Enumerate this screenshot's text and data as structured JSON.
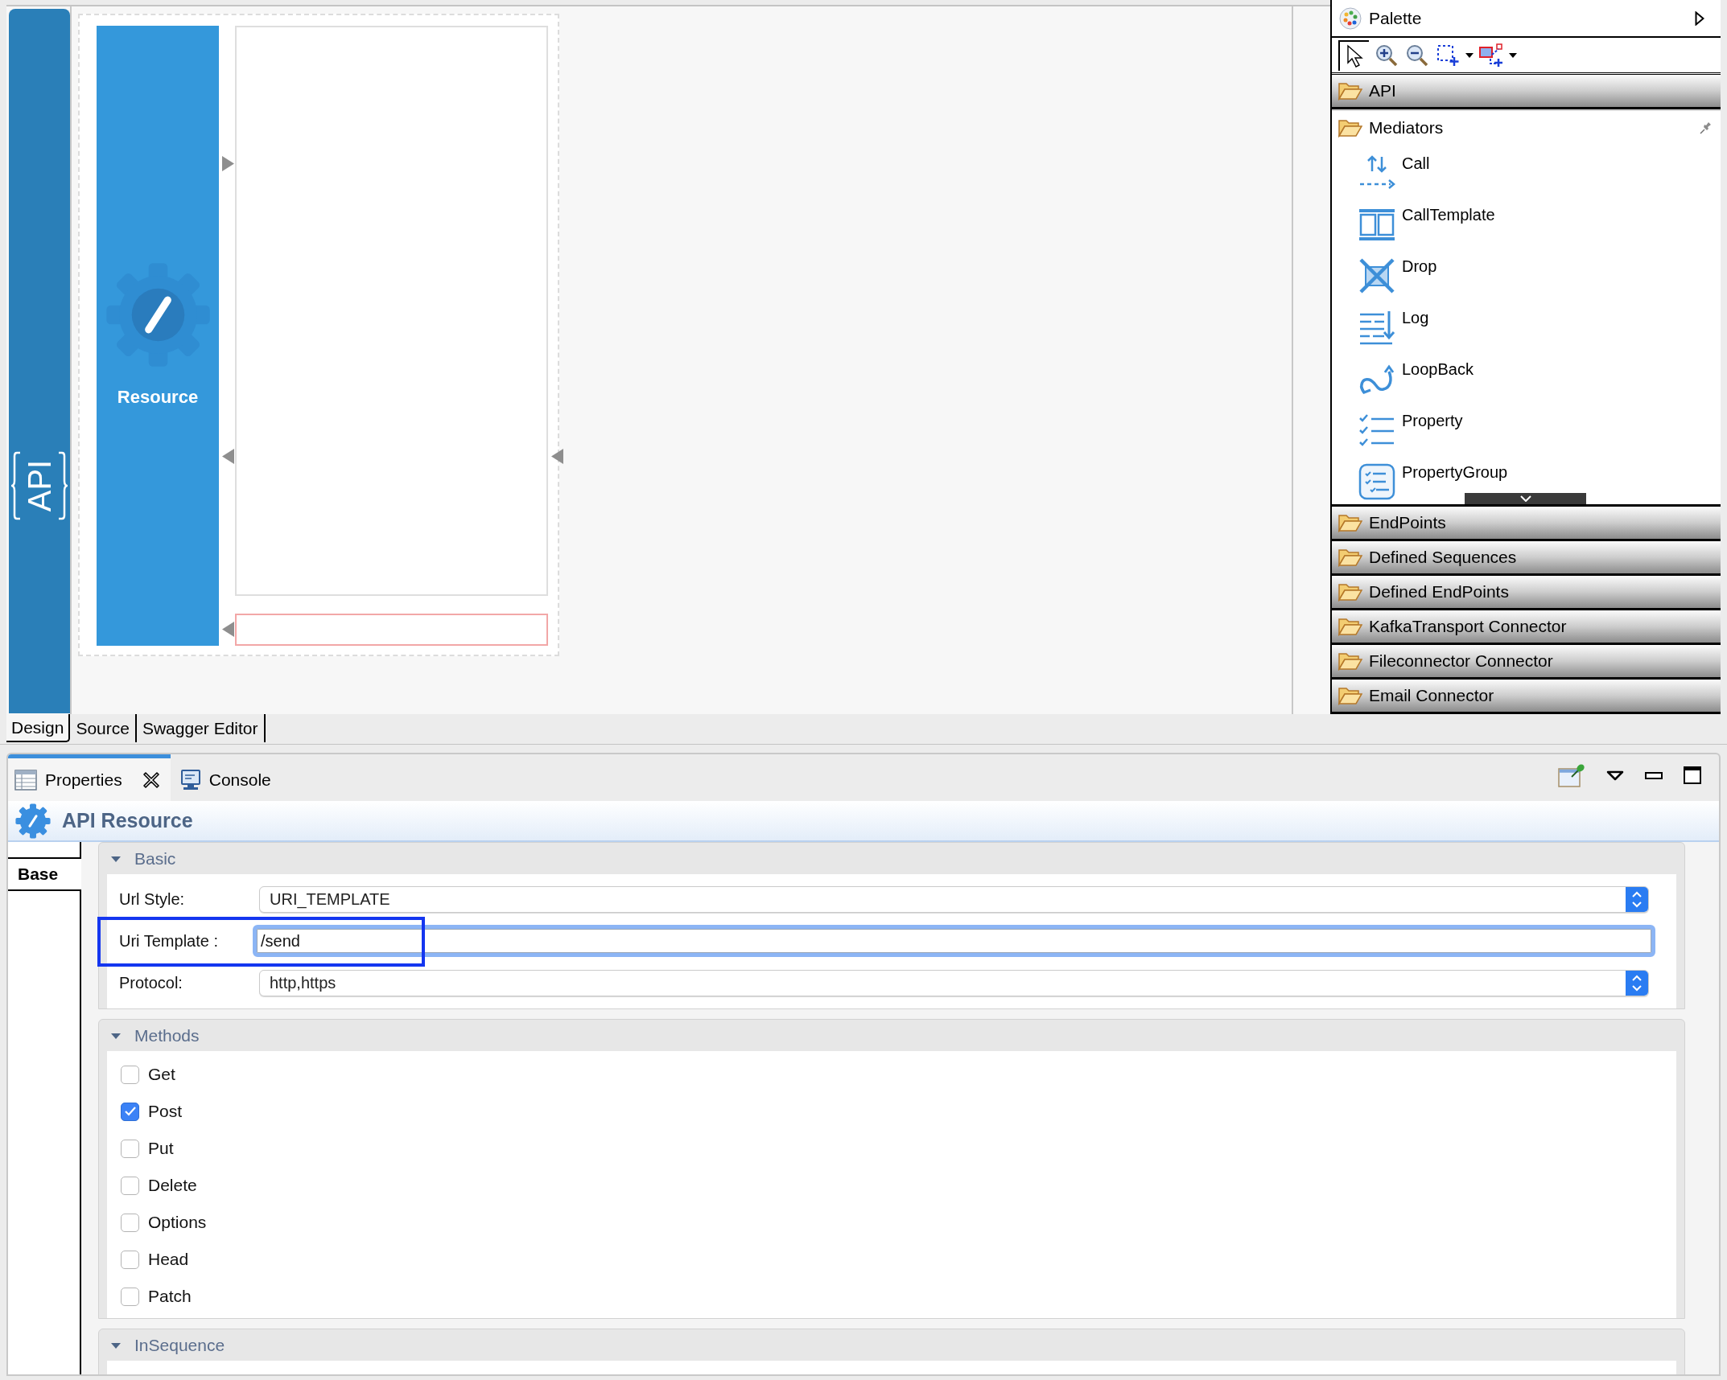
{
  "editor": {
    "logo": "API",
    "resource_label": "Resource"
  },
  "palette": {
    "title": "Palette",
    "tools": [
      {
        "kind": "select",
        "selected": true,
        "dropdown": false
      },
      {
        "kind": "zoom_in",
        "selected": false,
        "dropdown": false
      },
      {
        "kind": "zoom_out",
        "selected": false,
        "dropdown": false
      },
      {
        "kind": "marquee",
        "selected": false,
        "dropdown": true
      },
      {
        "kind": "connection",
        "selected": false,
        "dropdown": true
      }
    ],
    "drawers": [
      {
        "label": "API",
        "expanded": false,
        "pinned": false
      },
      {
        "label": "Mediators",
        "expanded": true,
        "pinned": true,
        "items": [
          {
            "label": "Call",
            "kind": "call"
          },
          {
            "label": "CallTemplate",
            "kind": "call_template"
          },
          {
            "label": "Drop",
            "kind": "drop"
          },
          {
            "label": "Log",
            "kind": "log"
          },
          {
            "label": "LoopBack",
            "kind": "loopback"
          },
          {
            "label": "Property",
            "kind": "property"
          },
          {
            "label": "PropertyGroup",
            "kind": "property_group"
          }
        ]
      },
      {
        "label": "EndPoints",
        "expanded": false,
        "pinned": false
      },
      {
        "label": "Defined Sequences",
        "expanded": false,
        "pinned": false
      },
      {
        "label": "Defined EndPoints",
        "expanded": false,
        "pinned": false
      },
      {
        "label": "KafkaTransport Connector",
        "expanded": false,
        "pinned": false
      },
      {
        "label": "Fileconnector Connector",
        "expanded": false,
        "pinned": false
      },
      {
        "label": "Email Connector",
        "expanded": false,
        "pinned": false
      }
    ]
  },
  "editor_tabs": [
    {
      "label": "Design",
      "selected": true
    },
    {
      "label": "Source",
      "selected": false
    },
    {
      "label": "Swagger Editor",
      "selected": false
    }
  ],
  "view_tabs": [
    {
      "label": "Properties",
      "kind": "properties",
      "selected": true,
      "closable": true
    },
    {
      "label": "Console",
      "kind": "console",
      "selected": false,
      "closable": false
    }
  ],
  "properties": {
    "title": "API Resource",
    "side_tabs": [
      {
        "label": "Base",
        "selected": true
      }
    ],
    "sections": [
      {
        "title": "Basic",
        "kind": "form",
        "expanded": true,
        "fields": [
          {
            "label": "Url Style:",
            "kind": "select",
            "value": "URI_TEMPLATE",
            "focused": false,
            "highlighted": false
          },
          {
            "label": "Uri Template :",
            "kind": "text",
            "value": "/send",
            "focused": true,
            "highlighted": true
          },
          {
            "label": "Protocol:",
            "kind": "select",
            "value": "http,https",
            "focused": false,
            "highlighted": false
          }
        ]
      },
      {
        "title": "Methods",
        "kind": "checklist",
        "expanded": true,
        "options": [
          {
            "label": "Get",
            "checked": false
          },
          {
            "label": "Post",
            "checked": true
          },
          {
            "label": "Put",
            "checked": false
          },
          {
            "label": "Delete",
            "checked": false
          },
          {
            "label": "Options",
            "checked": false
          },
          {
            "label": "Head",
            "checked": false
          },
          {
            "label": "Patch",
            "checked": false
          }
        ]
      },
      {
        "title": "InSequence",
        "kind": "sequence",
        "expanded": true
      }
    ]
  }
}
